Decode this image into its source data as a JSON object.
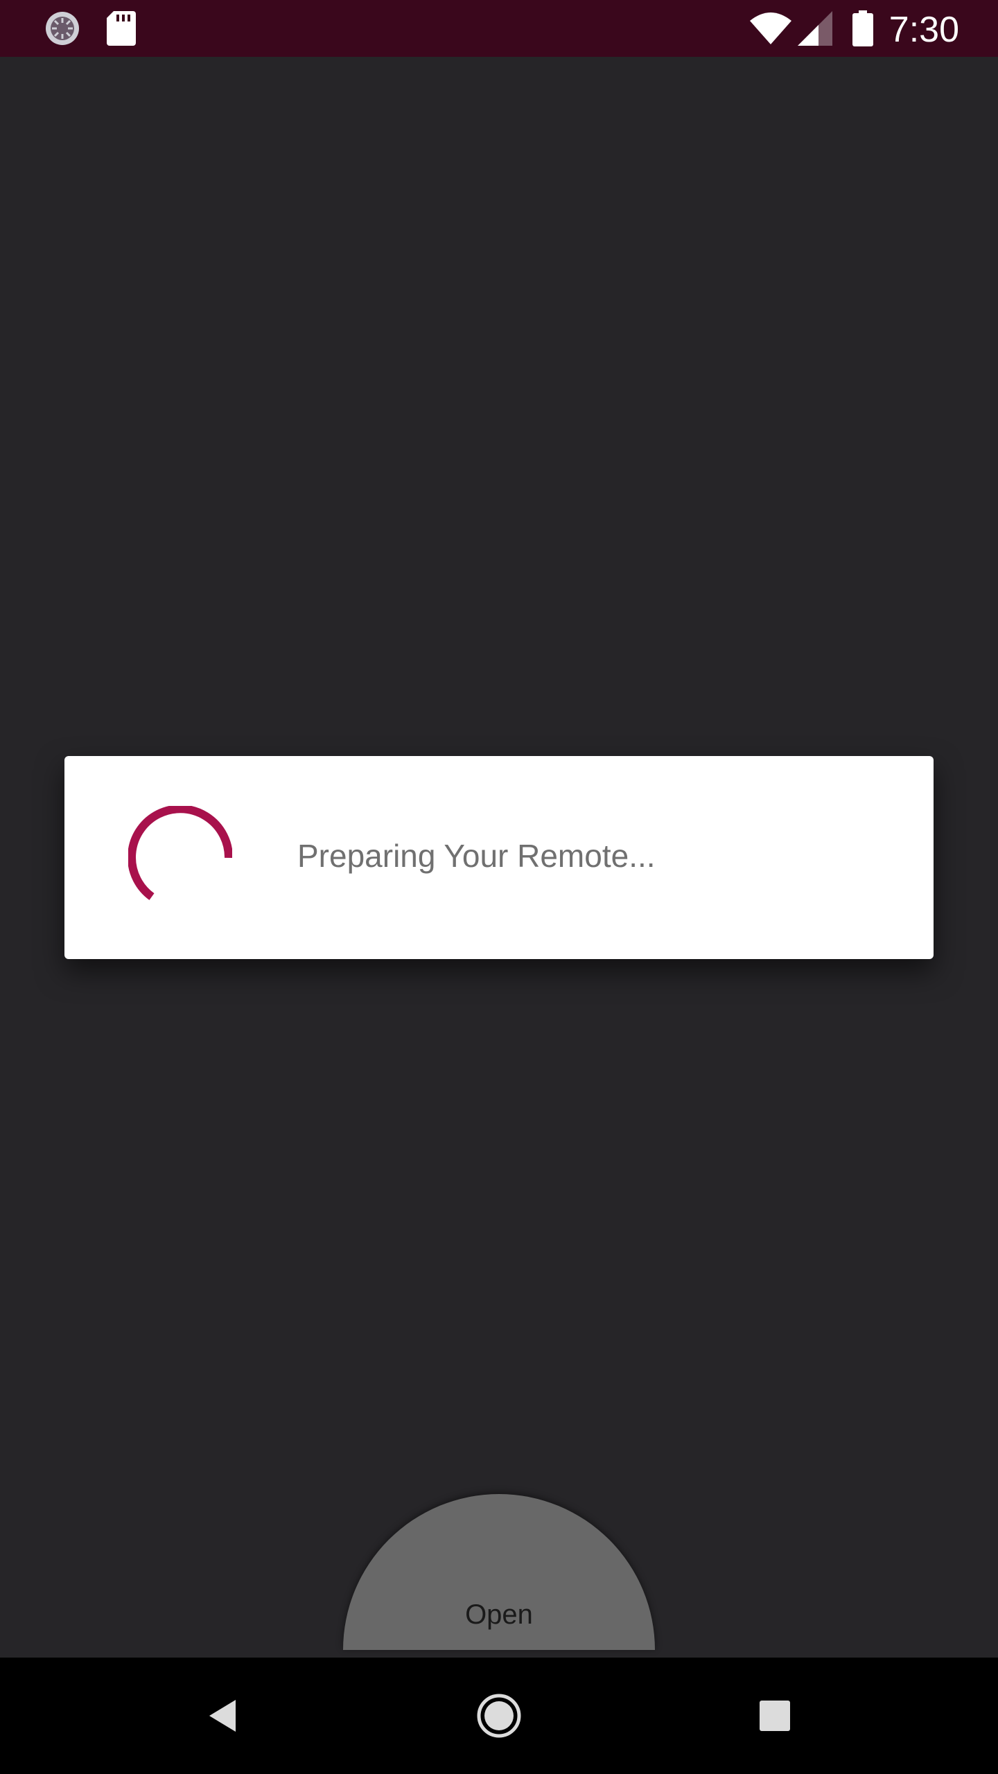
{
  "status_bar": {
    "time": "7:30",
    "icons": [
      "sync-icon",
      "sd-card-icon",
      "wifi-icon",
      "cell-signal-icon",
      "battery-icon"
    ],
    "background": "#3a071c"
  },
  "dialog": {
    "message": "Preparing Your Remote...",
    "spinner_color": "#a8114c"
  },
  "handle": {
    "label": "Open"
  },
  "nav_bar": {
    "icons": [
      "back-icon",
      "home-icon",
      "recents-icon"
    ]
  }
}
